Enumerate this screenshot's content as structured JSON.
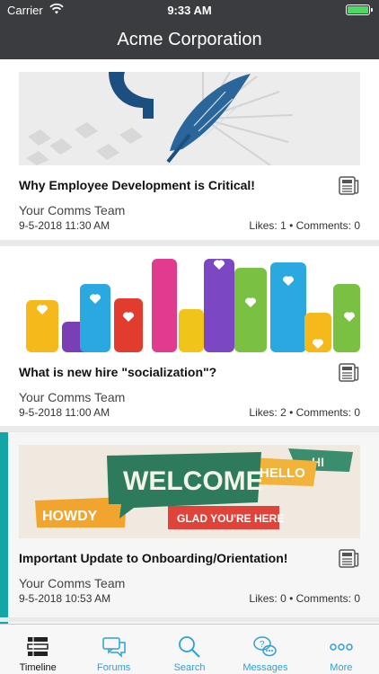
{
  "status_bar": {
    "carrier": "Carrier",
    "time": "9:33 AM"
  },
  "header": {
    "title": "Acme Corporation"
  },
  "feed": [
    {
      "title": "Why Employee Development is Critical!",
      "author": "Your Comms Team",
      "date": "9-5-2018 11:30 AM",
      "stats": "Likes: 1 • Comments: 0",
      "image": "quill-pen-illustration"
    },
    {
      "title": "What is new hire \"socialization\"?",
      "author": "Your Comms Team",
      "date": "9-5-2018 11:00 AM",
      "stats": "Likes: 2 • Comments: 0",
      "image": "raised-hands-illustration"
    },
    {
      "title": "Important Update to Onboarding/Orientation!",
      "author": "Your Comms Team",
      "date": "9-5-2018 10:53 AM",
      "stats": "Likes: 0 • Comments: 0",
      "image": "welcome-speech-bubbles-illustration"
    }
  ],
  "welcome_image": {
    "welcome": "WELCOME",
    "hello": "HELLO",
    "hi": "HI",
    "howdy": "HOWDY",
    "glad": "GLAD YOU'RE HERE"
  },
  "tabs": [
    {
      "label": "Timeline",
      "icon": "timeline-icon",
      "active": true
    },
    {
      "label": "Forums",
      "icon": "forums-icon"
    },
    {
      "label": "Search",
      "icon": "search-icon"
    },
    {
      "label": "Messages",
      "icon": "messages-icon"
    },
    {
      "label": "More",
      "icon": "more-icon"
    }
  ],
  "colors": {
    "header_bg": "#3b3c3f",
    "accent": "#14a6a6",
    "tab_blue": "#2f9fd4",
    "battery": "#4cd964"
  }
}
